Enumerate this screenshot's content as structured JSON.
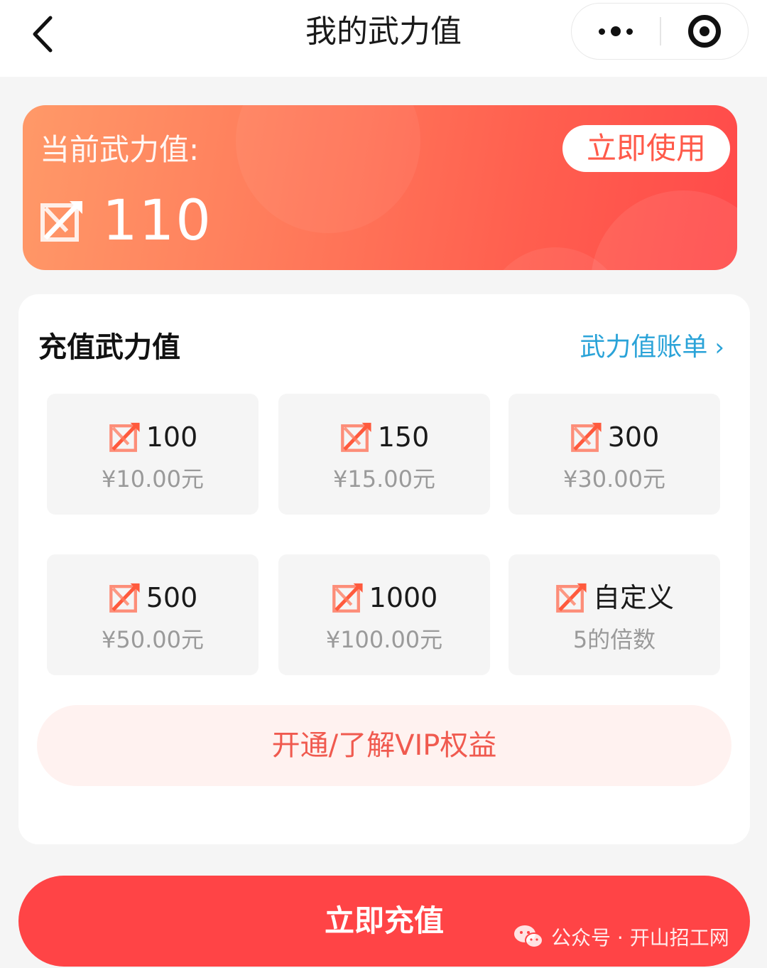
{
  "nav": {
    "title": "我的武力值"
  },
  "balance": {
    "label": "当前武力值:",
    "value": "110",
    "use_label": "立即使用"
  },
  "recharge": {
    "title": "充值武力值",
    "bill_link": "武力值账单",
    "packages": [
      {
        "amount": "100",
        "price": "¥10.00元"
      },
      {
        "amount": "150",
        "price": "¥15.00元"
      },
      {
        "amount": "300",
        "price": "¥30.00元"
      },
      {
        "amount": "500",
        "price": "¥50.00元"
      },
      {
        "amount": "1000",
        "price": "¥100.00元"
      },
      {
        "amount": "自定义",
        "price": "5的倍数"
      }
    ],
    "vip_label": "开通/了解VIP权益"
  },
  "cta": {
    "label": "立即充值"
  },
  "watermark": {
    "text": "公众号 · 开山招工网"
  },
  "colors": {
    "accent": "#ff4446",
    "link": "#2aa3d8",
    "icon_orange": "#ff6a4d"
  },
  "icons": {
    "power": "crossed-arrow-power-icon"
  }
}
